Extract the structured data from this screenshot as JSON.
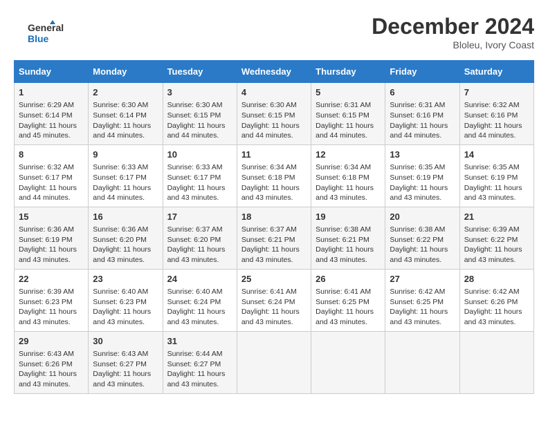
{
  "header": {
    "logo_line1": "General",
    "logo_line2": "Blue",
    "month_title": "December 2024",
    "subtitle": "Bloleu, Ivory Coast"
  },
  "days_of_week": [
    "Sunday",
    "Monday",
    "Tuesday",
    "Wednesday",
    "Thursday",
    "Friday",
    "Saturday"
  ],
  "weeks": [
    [
      {
        "day": "1",
        "sunrise": "6:29 AM",
        "sunset": "6:14 PM",
        "daylight": "11 hours and 45 minutes."
      },
      {
        "day": "2",
        "sunrise": "6:30 AM",
        "sunset": "6:14 PM",
        "daylight": "11 hours and 44 minutes."
      },
      {
        "day": "3",
        "sunrise": "6:30 AM",
        "sunset": "6:15 PM",
        "daylight": "11 hours and 44 minutes."
      },
      {
        "day": "4",
        "sunrise": "6:30 AM",
        "sunset": "6:15 PM",
        "daylight": "11 hours and 44 minutes."
      },
      {
        "day": "5",
        "sunrise": "6:31 AM",
        "sunset": "6:15 PM",
        "daylight": "11 hours and 44 minutes."
      },
      {
        "day": "6",
        "sunrise": "6:31 AM",
        "sunset": "6:16 PM",
        "daylight": "11 hours and 44 minutes."
      },
      {
        "day": "7",
        "sunrise": "6:32 AM",
        "sunset": "6:16 PM",
        "daylight": "11 hours and 44 minutes."
      }
    ],
    [
      {
        "day": "8",
        "sunrise": "6:32 AM",
        "sunset": "6:17 PM",
        "daylight": "11 hours and 44 minutes."
      },
      {
        "day": "9",
        "sunrise": "6:33 AM",
        "sunset": "6:17 PM",
        "daylight": "11 hours and 44 minutes."
      },
      {
        "day": "10",
        "sunrise": "6:33 AM",
        "sunset": "6:17 PM",
        "daylight": "11 hours and 43 minutes."
      },
      {
        "day": "11",
        "sunrise": "6:34 AM",
        "sunset": "6:18 PM",
        "daylight": "11 hours and 43 minutes."
      },
      {
        "day": "12",
        "sunrise": "6:34 AM",
        "sunset": "6:18 PM",
        "daylight": "11 hours and 43 minutes."
      },
      {
        "day": "13",
        "sunrise": "6:35 AM",
        "sunset": "6:19 PM",
        "daylight": "11 hours and 43 minutes."
      },
      {
        "day": "14",
        "sunrise": "6:35 AM",
        "sunset": "6:19 PM",
        "daylight": "11 hours and 43 minutes."
      }
    ],
    [
      {
        "day": "15",
        "sunrise": "6:36 AM",
        "sunset": "6:19 PM",
        "daylight": "11 hours and 43 minutes."
      },
      {
        "day": "16",
        "sunrise": "6:36 AM",
        "sunset": "6:20 PM",
        "daylight": "11 hours and 43 minutes."
      },
      {
        "day": "17",
        "sunrise": "6:37 AM",
        "sunset": "6:20 PM",
        "daylight": "11 hours and 43 minutes."
      },
      {
        "day": "18",
        "sunrise": "6:37 AM",
        "sunset": "6:21 PM",
        "daylight": "11 hours and 43 minutes."
      },
      {
        "day": "19",
        "sunrise": "6:38 AM",
        "sunset": "6:21 PM",
        "daylight": "11 hours and 43 minutes."
      },
      {
        "day": "20",
        "sunrise": "6:38 AM",
        "sunset": "6:22 PM",
        "daylight": "11 hours and 43 minutes."
      },
      {
        "day": "21",
        "sunrise": "6:39 AM",
        "sunset": "6:22 PM",
        "daylight": "11 hours and 43 minutes."
      }
    ],
    [
      {
        "day": "22",
        "sunrise": "6:39 AM",
        "sunset": "6:23 PM",
        "daylight": "11 hours and 43 minutes."
      },
      {
        "day": "23",
        "sunrise": "6:40 AM",
        "sunset": "6:23 PM",
        "daylight": "11 hours and 43 minutes."
      },
      {
        "day": "24",
        "sunrise": "6:40 AM",
        "sunset": "6:24 PM",
        "daylight": "11 hours and 43 minutes."
      },
      {
        "day": "25",
        "sunrise": "6:41 AM",
        "sunset": "6:24 PM",
        "daylight": "11 hours and 43 minutes."
      },
      {
        "day": "26",
        "sunrise": "6:41 AM",
        "sunset": "6:25 PM",
        "daylight": "11 hours and 43 minutes."
      },
      {
        "day": "27",
        "sunrise": "6:42 AM",
        "sunset": "6:25 PM",
        "daylight": "11 hours and 43 minutes."
      },
      {
        "day": "28",
        "sunrise": "6:42 AM",
        "sunset": "6:26 PM",
        "daylight": "11 hours and 43 minutes."
      }
    ],
    [
      {
        "day": "29",
        "sunrise": "6:43 AM",
        "sunset": "6:26 PM",
        "daylight": "11 hours and 43 minutes."
      },
      {
        "day": "30",
        "sunrise": "6:43 AM",
        "sunset": "6:27 PM",
        "daylight": "11 hours and 43 minutes."
      },
      {
        "day": "31",
        "sunrise": "6:44 AM",
        "sunset": "6:27 PM",
        "daylight": "11 hours and 43 minutes."
      },
      null,
      null,
      null,
      null
    ]
  ],
  "labels": {
    "sunrise": "Sunrise:",
    "sunset": "Sunset:",
    "daylight": "Daylight:"
  }
}
